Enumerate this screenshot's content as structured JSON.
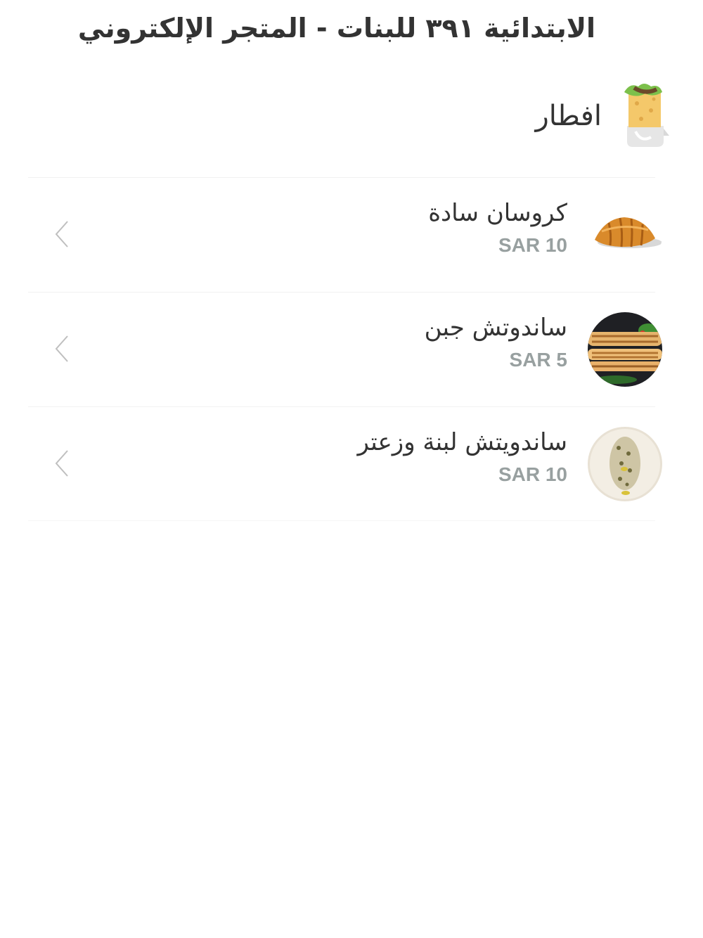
{
  "header": {
    "title": "الابتدائية ٣٩١ للبنات - المتجر الإلكتروني"
  },
  "category": {
    "title": "افطار",
    "icon": "wrap-sandwich-icon"
  },
  "items": [
    {
      "name": "كروسان سادة",
      "price": "SAR 10",
      "image": "croissant-image"
    },
    {
      "name": "ساندوتش جبن",
      "price": "SAR 5",
      "image": "cheese-sandwich-image"
    },
    {
      "name": "ساندويتش لبنة وزعتر",
      "price": "SAR 10",
      "image": "labneh-zaatar-image"
    }
  ],
  "colors": {
    "text": "#333333",
    "price": "#98a0a0",
    "divider": "#f1f1f1",
    "chevron": "#bfbfbf"
  }
}
